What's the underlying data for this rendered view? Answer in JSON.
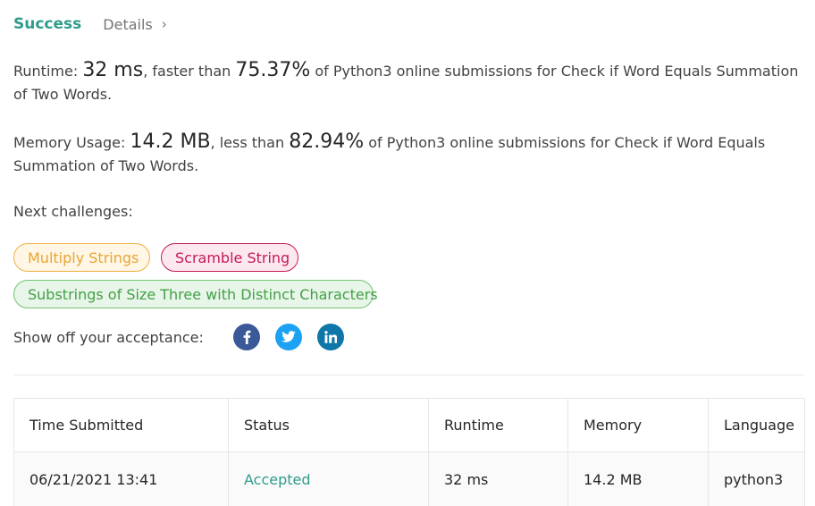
{
  "header": {
    "status": "Success",
    "details_label": "Details",
    "chevron_glyph": "›"
  },
  "runtime_stat": {
    "label": "Runtime: ",
    "value": "32 ms",
    "comparison_prefix": ", faster than ",
    "percent": "75.37%",
    "suffix": " of Python3 online submissions for Check if Word Equals Summation of Two Words."
  },
  "memory_stat": {
    "label": "Memory Usage: ",
    "value": "14.2 MB",
    "comparison_prefix": ", less than ",
    "percent": "82.94%",
    "suffix": " of Python3 online submissions for Check if Word Equals Summation of Two Words."
  },
  "next_challenges": {
    "title": "Next challenges:",
    "items": [
      {
        "label": "Multiply Strings",
        "difficulty_color": "#f0b040"
      },
      {
        "label": "Scramble String",
        "difficulty_color": "#c5195a"
      },
      {
        "label": "Substrings of Size Three with Distinct Characters",
        "difficulty_color": "#73c46f"
      }
    ]
  },
  "share": {
    "label": "Show off your acceptance:",
    "icons": [
      "facebook-icon",
      "twitter-icon",
      "linkedin-icon"
    ]
  },
  "table": {
    "columns": [
      "Time Submitted",
      "Status",
      "Runtime",
      "Memory",
      "Language"
    ],
    "rows": [
      {
        "time": "06/21/2021 13:41",
        "status": "Accepted",
        "runtime": "32 ms",
        "memory": "14.2 MB",
        "language": "python3"
      }
    ]
  },
  "colors": {
    "accent": "#2e9c8c",
    "facebook": "#3b5998",
    "twitter": "#1da1f2",
    "linkedin": "#0e76a8"
  }
}
